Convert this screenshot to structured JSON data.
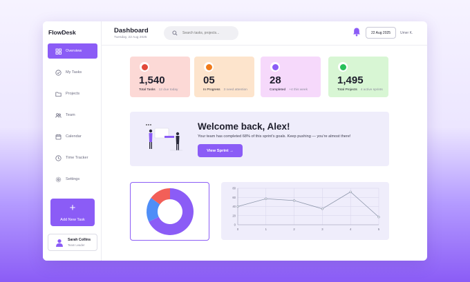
{
  "sidebar": {
    "brand": "FlowDesk",
    "items": [
      {
        "label": "Overview",
        "icon": "grid-icon",
        "active": true
      },
      {
        "label": "My Tasks",
        "icon": "check-circle-icon"
      },
      {
        "label": "Projects",
        "icon": "folder-icon"
      },
      {
        "label": "Team",
        "icon": "users-icon"
      },
      {
        "label": "Calendar",
        "icon": "calendar-icon"
      },
      {
        "label": "Time Tracker",
        "icon": "clock-icon"
      },
      {
        "label": "Settings",
        "icon": "gear-icon"
      }
    ],
    "add_task": {
      "label": "Add New Task",
      "icon": "plus-icon"
    },
    "profile": {
      "name": "Sarah Collins",
      "role": "Team Leader"
    }
  },
  "header": {
    "title": "Dashboard",
    "date": "Tuesday, 22 Aug 2025",
    "search_placeholder": "Search tasks, projects...",
    "date_pill": "22 Aug 2025",
    "user": "Umer K."
  },
  "stats": [
    {
      "value": "1,540",
      "label": "Total Tasks",
      "sub": "12 due today",
      "bg": "#fcd9d6",
      "dot": "#e24a3b"
    },
    {
      "value": "05",
      "label": "In Progress",
      "sub": "3 need attention",
      "bg": "#fde4cc",
      "dot": "#f07a1a"
    },
    {
      "value": "28",
      "label": "Completed",
      "sub": "+4 this week",
      "bg": "#f6d9fb",
      "dot": "#8b5cf6"
    },
    {
      "value": "1,495",
      "label": "Total Projects",
      "sub": "4 active sprints",
      "bg": "#d8f6d4",
      "dot": "#27c05a"
    }
  ],
  "welcome": {
    "title": "Welcome back, Alex!",
    "text": "Your team has completed 68% of this sprint's goals. Keep pushing — you're almost there!",
    "button": "View Sprint →"
  },
  "donut": {
    "slices": [
      {
        "value": 0.68,
        "color": "#8b5cf6"
      },
      {
        "value": 0.17,
        "color": "#4f8ef7"
      },
      {
        "value": 0.15,
        "color": "#f25f58"
      }
    ]
  },
  "chart_data": {
    "type": "line",
    "x": [
      0,
      1,
      2,
      3,
      4,
      5
    ],
    "values": [
      40,
      57,
      53,
      35,
      72,
      17
    ],
    "ylim": [
      0,
      80
    ],
    "xlim": [
      0,
      5
    ],
    "yticks": [
      "0",
      "20",
      "40",
      "60",
      "80"
    ],
    "xticks": [
      "0",
      "1",
      "2",
      "3",
      "4",
      "5"
    ],
    "grid": true,
    "line_color": "#8a94a8"
  }
}
